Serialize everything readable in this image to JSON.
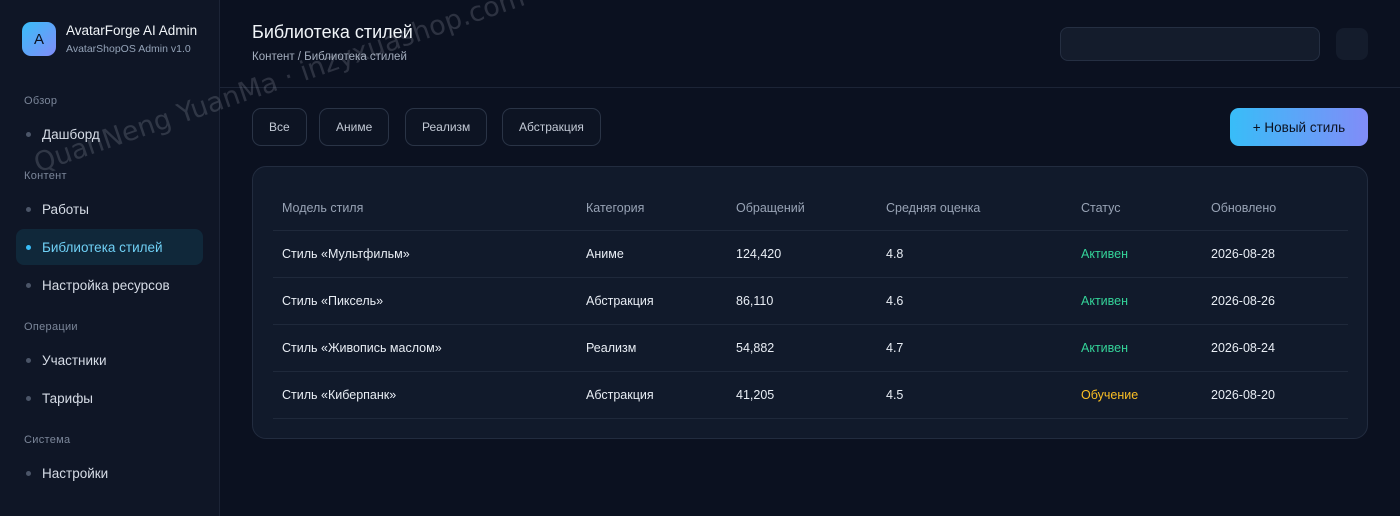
{
  "sidebar": {
    "logo_letter": "A",
    "app_title": "AvatarForge AI Admin",
    "app_subtitle": "AvatarShopOS Admin v1.0",
    "sections": [
      {
        "title": "Обзор",
        "items": [
          {
            "label": "Дашборд",
            "icon": "dot-icon"
          }
        ]
      },
      {
        "title": "Контент",
        "items": [
          {
            "label": "Работы",
            "icon": "dot-icon"
          },
          {
            "label": "Библиотека стилей",
            "icon": "dot-icon",
            "active": true
          },
          {
            "label": "Настройка ресурсов",
            "icon": "dot-icon"
          }
        ]
      },
      {
        "title": "Операции",
        "items": [
          {
            "label": "Участники",
            "icon": "dot-icon"
          },
          {
            "label": "Тарифы",
            "icon": "dot-icon"
          }
        ]
      },
      {
        "title": "Система",
        "items": [
          {
            "label": "Настройки",
            "icon": "dot-icon"
          }
        ]
      }
    ]
  },
  "header": {
    "title": "Библиотека стилей",
    "breadcrumb": "Контент / Библиотека стилей",
    "search_value": ""
  },
  "filters": [
    "Все",
    "Аниме",
    "Реализм",
    "Абстракция"
  ],
  "new_button_label": "+ Новый стиль",
  "table": {
    "columns": [
      "Модель стиля",
      "Категория",
      "Обращений",
      "Средняя оценка",
      "Статус",
      "Обновлено"
    ],
    "rows": [
      [
        "Стиль «Мультфильм»",
        "Аниме",
        "124,420",
        "4.8",
        "Активен",
        "2026-08-28"
      ],
      [
        "Стиль «Пиксель»",
        "Абстракция",
        "86,110",
        "4.6",
        "Активен",
        "2026-08-26"
      ],
      [
        "Стиль «Живопись маслом»",
        "Реализм",
        "54,882",
        "4.7",
        "Активен",
        "2026-08-24"
      ],
      [
        "Стиль «Киберпанк»",
        "Абстракция",
        "41,205",
        "4.5",
        "Обучение",
        "2026-08-20"
      ]
    ]
  },
  "watermark": "QuanNeng YuanMa · inzyxuashop.com",
  "colors": {
    "accent": "#38bdf8",
    "accent_end": "#818cf8",
    "status_active": "#34d399",
    "status_training": "#fbbf24",
    "background": "#0b1120"
  }
}
